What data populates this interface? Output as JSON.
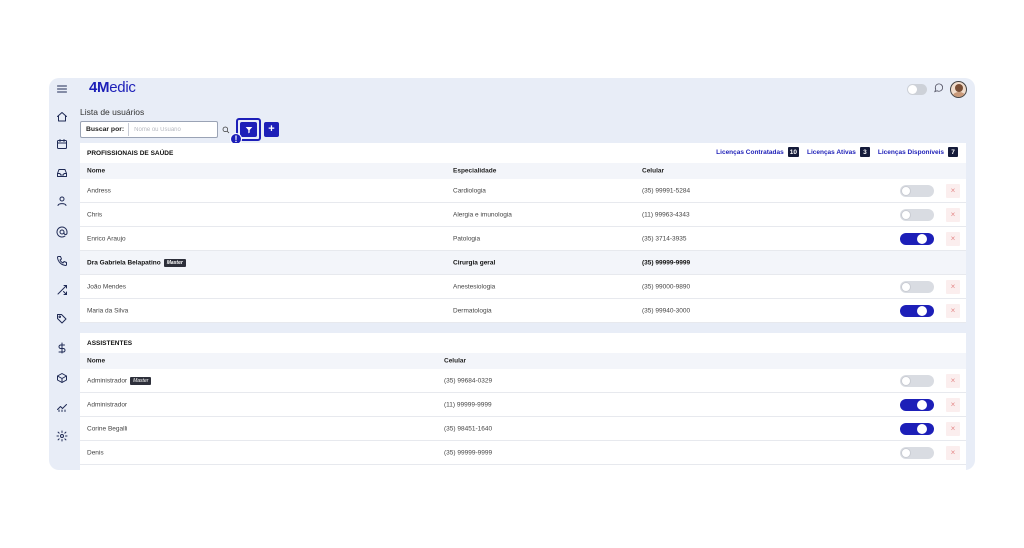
{
  "app": {
    "logo_bold": "4M",
    "logo_rest": "edic"
  },
  "sidebar": {
    "icons": [
      "menu-icon",
      "home-icon",
      "calendar-icon",
      "inbox-icon",
      "user-icon",
      "at-sign-icon",
      "phone-icon",
      "shuffle-icon",
      "tag-icon",
      "dollar-icon",
      "box-icon",
      "chart-icon",
      "settings-icon"
    ]
  },
  "page": {
    "title": "Lista de usuários"
  },
  "search": {
    "label": "Buscar por:",
    "placeholder": "Nome ou Usuário",
    "alert": "!",
    "add_label": "+"
  },
  "professionals": {
    "title": "PROFISSIONAIS DE SAÚDE",
    "licenses": [
      {
        "label": "Licenças Contratadas",
        "count": "10"
      },
      {
        "label": "Licenças Ativas",
        "count": "3"
      },
      {
        "label": "Licenças Disponíveis",
        "count": "7"
      }
    ],
    "columns": {
      "name": "Nome",
      "specialty": "Especialidade",
      "phone": "Celular"
    },
    "rows": [
      {
        "name": "Andress",
        "specialty": "Cardiologia",
        "phone": "(35) 99991-5284",
        "active": false
      },
      {
        "name": "Chris",
        "specialty": "Alergia e imunologia",
        "phone": "(11) 99963-4343",
        "active": false
      },
      {
        "name": "Enrico Araujo",
        "specialty": "Patologia",
        "phone": "(35) 3714-3935",
        "active": true
      },
      {
        "name": "Dra Gabriela Belapatino",
        "badge": "Master",
        "specialty": "Cirurgia geral",
        "phone": "(35) 99999-9999",
        "master": true
      },
      {
        "name": "João Mendes",
        "specialty": "Anestesiologia",
        "phone": "(35) 99000-9890",
        "active": false
      },
      {
        "name": "Maria da Silva",
        "specialty": "Dermatologia",
        "phone": "(35) 99940-3000",
        "active": true
      }
    ]
  },
  "assistants": {
    "title": "ASSISTENTES",
    "columns": {
      "name": "Nome",
      "phone": "Celular"
    },
    "rows": [
      {
        "name": "Administrador",
        "badge": "Master",
        "phone": "(35) 99684-0329",
        "active": false
      },
      {
        "name": "Administrador",
        "phone": "(11) 99999-9999",
        "active": true
      },
      {
        "name": "Corine Begalli",
        "phone": "(35) 98451-1640",
        "active": true
      },
      {
        "name": "Denis",
        "phone": "(35) 99999-9999",
        "active": false
      }
    ]
  },
  "delete_symbol": "×",
  "colors": {
    "brand": "#1d1fb8",
    "background": "#e8edf7",
    "delete": "#e58a8a"
  }
}
